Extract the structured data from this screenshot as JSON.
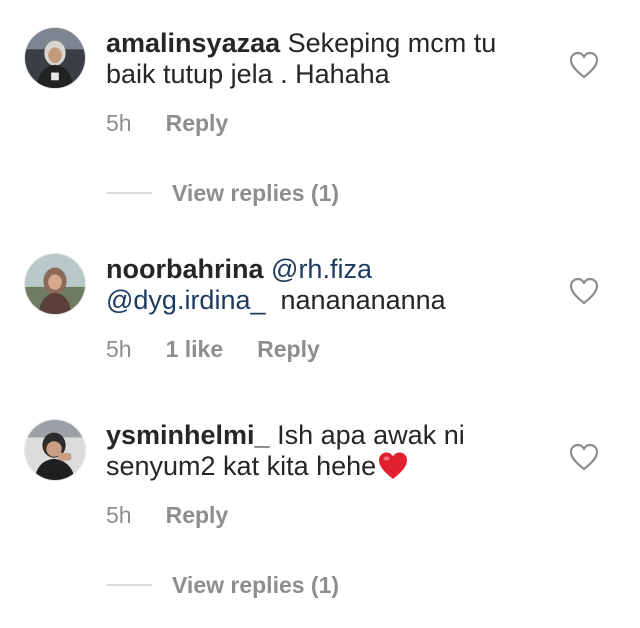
{
  "comments": [
    {
      "username": "amalinsyazaa",
      "text_line1": "Sekeping mcm tu",
      "text_line2": "baik tutup jela . Hahaha",
      "time": "5h",
      "reply_label": "Reply",
      "view_replies": "View replies (1)"
    },
    {
      "username": "noorbahrina",
      "mention1": "@rh.fiza",
      "mention2": "@dyg.irdina_",
      "text_after": "nananananna",
      "time": "5h",
      "likes": "1 like",
      "reply_label": "Reply"
    },
    {
      "username": "ysminhelmi_",
      "text_line1": "Ish apa awak ni",
      "text_line2": "senyum2 kat kita hehe",
      "emoji": "red-heart-emoji",
      "time": "5h",
      "reply_label": "Reply",
      "view_replies": "View replies (1)"
    }
  ],
  "icons": {
    "like": "heart-outline-icon"
  },
  "colors": {
    "text": "#262626",
    "muted": "#8e8e8e",
    "mention": "#1e3a5f",
    "heart_emoji": "#e0202e"
  }
}
